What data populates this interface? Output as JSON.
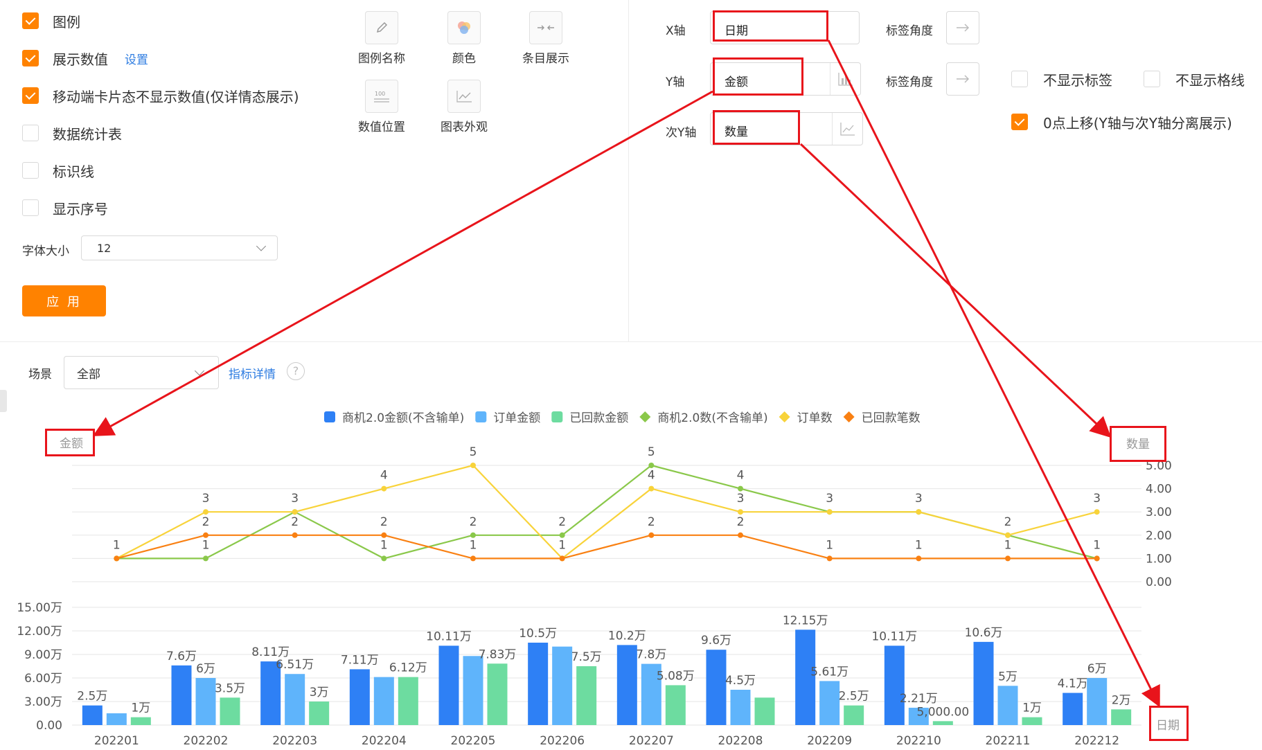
{
  "settings": {
    "checkboxes": [
      {
        "label": "图例",
        "checked": true
      },
      {
        "label": "展示数值",
        "checked": true,
        "link": "设置"
      },
      {
        "label": "移动端卡片态不显示数值(仅详情态展示)",
        "checked": true
      },
      {
        "label": "数据统计表",
        "checked": false
      },
      {
        "label": "标识线",
        "checked": false
      },
      {
        "label": "显示序号",
        "checked": false
      }
    ],
    "font_size_label": "字体大小",
    "font_size_value": "12",
    "apply_label": "应 用",
    "tools": [
      {
        "label": "图例名称",
        "icon": "pencil-icon"
      },
      {
        "label": "颜色",
        "icon": "color-palette-icon"
      },
      {
        "label": "条目展示",
        "icon": "collapse-arrows-icon"
      },
      {
        "label": "数值位置",
        "icon": "value-position-icon"
      },
      {
        "label": "图表外观",
        "icon": "line-chart-icon"
      }
    ],
    "axes": {
      "x_label": "X轴",
      "x_value": "日期",
      "y_label": "Y轴",
      "y_value": "金额",
      "y2_label": "次Y轴",
      "y2_value": "数量",
      "angle_label": "标签角度"
    },
    "options": [
      {
        "label": "不显示标签",
        "checked": false
      },
      {
        "label": "不显示格线",
        "checked": false
      },
      {
        "label": "0点上移(Y轴与次Y轴分离展示)",
        "checked": true
      }
    ]
  },
  "scene": {
    "label": "场景",
    "value": "全部",
    "details_link": "指标详情",
    "help_icon": "?"
  },
  "colors": {
    "accent": "#ff8200",
    "link": "#2f7de1",
    "annotation_red": "#e8141b"
  },
  "chart_data": {
    "type": "bar",
    "categories": [
      "202201",
      "202202",
      "202203",
      "202204",
      "202205",
      "202206",
      "202207",
      "202208",
      "202209",
      "202210",
      "202211",
      "202212"
    ],
    "series": [
      {
        "name": "商机2.0金额(不含输单)",
        "kind": "bar",
        "color": "#2e80f5",
        "values": [
          25000,
          76000,
          81100,
          71100,
          101100,
          105000,
          102000,
          96000,
          121500,
          101100,
          106000,
          41000
        ],
        "labels": [
          "2.5万",
          "7.6万",
          "8.11万",
          "7.11万",
          "10.11万",
          "10.5万",
          "10.2万",
          "9.6万",
          "12.15万",
          "10.11万",
          "10.6万",
          "4.1万"
        ]
      },
      {
        "name": "订单金额",
        "kind": "bar",
        "color": "#5fb4fb",
        "values": [
          15000,
          60000,
          65100,
          61200,
          88000,
          100000,
          78000,
          45000,
          56100,
          22100,
          50000,
          60000
        ],
        "labels": [
          "",
          "6万",
          "6.51万",
          "",
          "",
          "",
          "7.8万",
          "4.5万",
          "5.61万",
          "2.21万",
          "5万",
          "6万"
        ]
      },
      {
        "name": "已回款金额",
        "kind": "bar",
        "color": "#6ddca0",
        "values": [
          10000,
          35000,
          30000,
          61200,
          78300,
          75000,
          50800,
          35000,
          25000,
          5000,
          10000,
          20000
        ],
        "labels": [
          "1万",
          "3.5万",
          "3万",
          "6.12万",
          "7.83万",
          "7.5万",
          "5.08万",
          "",
          "2.5万",
          "5,000.00",
          "1万",
          "2万"
        ]
      },
      {
        "name": "商机2.0数(不含输单)",
        "kind": "line",
        "color": "#8ac84a",
        "values": [
          1,
          1,
          3,
          1,
          2,
          2,
          5,
          4,
          3,
          3,
          2,
          1
        ]
      },
      {
        "name": "订单数",
        "kind": "line",
        "color": "#f8d33a",
        "values": [
          1,
          3,
          3,
          4,
          5,
          1,
          4,
          3,
          3,
          3,
          2,
          3
        ]
      },
      {
        "name": "已回款笔数",
        "kind": "line",
        "color": "#f98012",
        "values": [
          1,
          2,
          2,
          2,
          1,
          1,
          2,
          2,
          1,
          1,
          1,
          1
        ]
      }
    ],
    "line_point_labels": [
      "1",
      "3",
      "3",
      "4",
      "5",
      "2",
      "5",
      "4",
      "3",
      "3",
      "2",
      "3"
    ],
    "line_point_labels2": [
      "",
      "2",
      "2",
      "2",
      "2",
      "1",
      "4",
      "3",
      "",
      "",
      "",
      ""
    ],
    "line_point_labels3": [
      "",
      "1",
      "",
      "1",
      "1",
      "",
      "2",
      "2",
      "1",
      "1",
      "1",
      "1"
    ],
    "y_title": "金额",
    "y2_title": "数量",
    "x_title": "日期",
    "y_ticks": [
      "0.00",
      "3.00万",
      "6.00万",
      "9.00万",
      "12.00万",
      "15.00万"
    ],
    "y_range": [
      0,
      150000
    ],
    "y2_ticks": [
      "0.00",
      "1.00",
      "2.00",
      "3.00",
      "4.00",
      "5.00"
    ],
    "y2_range": [
      0,
      5
    ],
    "grid": true,
    "legend_position": "top"
  }
}
